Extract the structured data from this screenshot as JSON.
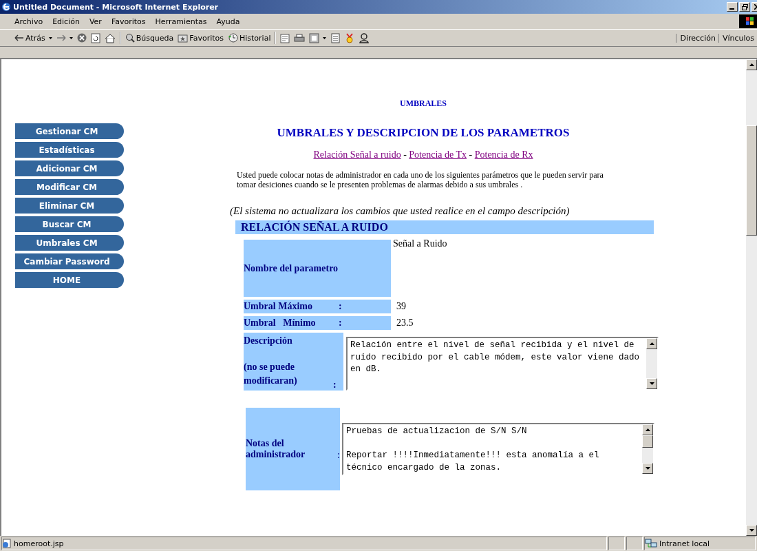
{
  "window": {
    "title": "Untitled Document - Microsoft Internet Explorer"
  },
  "menu_bar": [
    "Archivo",
    "Edición",
    "Ver",
    "Favoritos",
    "Herramientas",
    "Ayuda"
  ],
  "toolbar": [
    {
      "kind": "back",
      "label": "Atrás"
    },
    {
      "kind": "forward"
    },
    {
      "kind": "stop"
    },
    {
      "kind": "refresh"
    },
    {
      "kind": "home"
    },
    {
      "kind": "search",
      "label": "Búsqueda"
    },
    {
      "kind": "favorites",
      "label": "Favoritos"
    },
    {
      "kind": "history",
      "label": "Historial"
    },
    {
      "kind": "mail"
    },
    {
      "kind": "print"
    },
    {
      "kind": "edit"
    },
    {
      "kind": "discuss"
    },
    {
      "kind": "messenger"
    },
    {
      "kind": "people"
    }
  ],
  "toolbar_right": [
    "Dirección",
    "Vínculos"
  ],
  "sidebar": {
    "items": [
      "Gestionar CM",
      "Estadísticas",
      "Adicionar CM",
      "Modificar CM",
      "Eliminar CM",
      "Buscar CM",
      "Umbrales CM",
      "Cambiar Password",
      "HOME"
    ]
  },
  "page": {
    "kicker": "UMBRALES",
    "title": "UMBRALES Y DESCRIPCION DE LOS PARAMETROS",
    "links": [
      {
        "label": "Relación Señal a ruido"
      },
      {
        "label": "Potencia de Tx"
      },
      {
        "label": "Potencia de Rx"
      }
    ],
    "link_separator": "-",
    "intro": "Usted puede colocar notas de administrador en cada uno de los siguientes parámetros que le pueden servir para tomar desiciones cuando se le presenten problemas de alarmas debido a sus umbrales .",
    "notice": "(El sistema no actualizara los cambios que usted realice en el campo descripción)",
    "section": {
      "heading": "RELACIÓN SEÑAL A RUIDO",
      "rows": [
        {
          "kind": "tall",
          "label": "Nombre del parametro",
          "value": "Señal a Ruido"
        },
        {
          "kind": "short",
          "label": "Umbral Máximo",
          "colon": ":",
          "value": "39"
        },
        {
          "kind": "short",
          "label": "Umbral   Mínimo",
          "colon": ":",
          "value": "23.5"
        }
      ],
      "description": {
        "label": "Descripción",
        "note": "(no se puede modificaran)",
        "colon": ":",
        "text": "Relación entre el nivel de señal recibida y el nivel de ruido recibido por el cable módem, este valor viene dado en dB."
      },
      "notes": {
        "label": "Notas del administrador",
        "colon": ":",
        "text": "Pruebas de actualizacion de S/N S/N\n\nReportar !!!!Inmediatamente!!! esta anomalía a el técnico encargado de la zonas."
      }
    }
  },
  "status_bar": {
    "url": "homeroot.jsp",
    "zone": "Intranet local"
  }
}
